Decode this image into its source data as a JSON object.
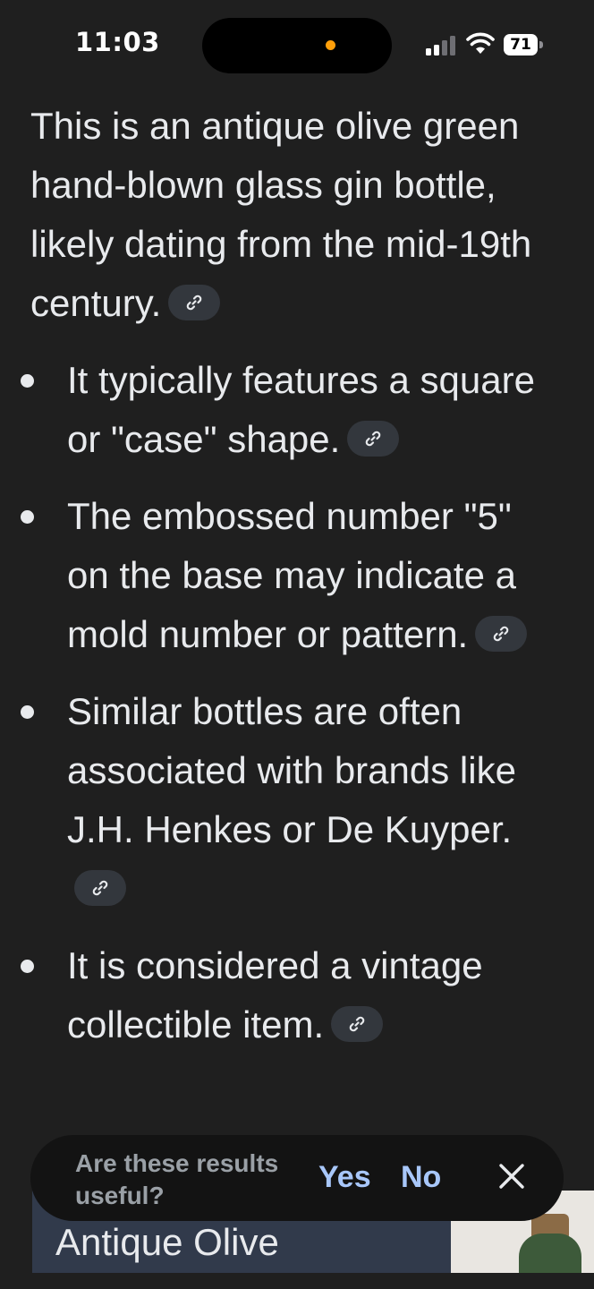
{
  "status_bar": {
    "time": "11:03",
    "battery": "71"
  },
  "answer": {
    "intro": "This is an antique olive green hand-blown glass gin bottle, likely dating from the mid-19th century.",
    "bullets": [
      "It typically features a square or \"case\" shape.",
      "The embossed number \"5\" on the base may indicate a mold number or pattern.",
      "Similar bottles are often associated with brands like J.H. Henkes or De Kuyper.",
      "It is considered a vintage collectible item."
    ]
  },
  "feedback": {
    "question": "Are these results useful?",
    "yes_label": "Yes",
    "no_label": "No"
  },
  "result_card": {
    "title": "Antique Olive"
  },
  "icons": {
    "citation": "link-icon",
    "close": "close-icon",
    "signal": "cellular-signal-icon",
    "wifi": "wifi-icon",
    "battery": "battery-icon"
  },
  "colors": {
    "background": "#1f1f1f",
    "accent": "#a8c7fa",
    "chip": "#33373d",
    "card": "#313a4b"
  }
}
